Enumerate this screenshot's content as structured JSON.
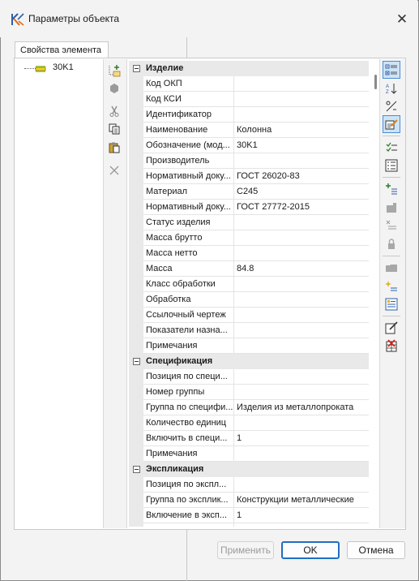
{
  "window": {
    "title": "Параметры объекта",
    "app_icon": "app-logo-icon",
    "close_icon": "close-icon"
  },
  "tab": {
    "label": "Свойства элемента"
  },
  "tree": {
    "node_label": "30K1",
    "node_icon": "beam-element-icon"
  },
  "left_toolbar": {
    "buttons": [
      "add-child-icon",
      "add-element-icon",
      "cut-icon",
      "copy-icon",
      "paste-icon",
      "delete-icon"
    ]
  },
  "grid": {
    "categories": [
      {
        "label": "Изделие",
        "rows": [
          {
            "name": "Код ОКП",
            "value": ""
          },
          {
            "name": "Код КСИ",
            "value": ""
          },
          {
            "name": "Идентификатор",
            "value": ""
          },
          {
            "name": "Наименование",
            "value": "Колонна"
          },
          {
            "name": "Обозначение (мод...",
            "value": "30K1"
          },
          {
            "name": "Производитель",
            "value": ""
          },
          {
            "name": "Нормативный доку...",
            "value": "ГОСТ 26020-83"
          },
          {
            "name": "Материал",
            "value": "С245"
          },
          {
            "name": "Нормативный доку...",
            "value": "ГОСТ 27772-2015"
          },
          {
            "name": "Статус изделия",
            "value": ""
          },
          {
            "name": "Масса брутто",
            "value": ""
          },
          {
            "name": "Масса нетто",
            "value": ""
          },
          {
            "name": "Масса",
            "value": "84.8"
          },
          {
            "name": "Класс обработки",
            "value": ""
          },
          {
            "name": "Обработка",
            "value": ""
          },
          {
            "name": "Ссылочный чертеж",
            "value": ""
          },
          {
            "name": "Показатели назна...",
            "value": ""
          },
          {
            "name": "Примечания",
            "value": ""
          }
        ]
      },
      {
        "label": "Спецификация",
        "rows": [
          {
            "name": "Позиция по специ...",
            "value": ""
          },
          {
            "name": "Номер группы",
            "value": ""
          },
          {
            "name": "Группа по специфи...",
            "value": "Изделия из металлопроката"
          },
          {
            "name": "Количество единиц",
            "value": ""
          },
          {
            "name": "Включить в специ...",
            "value": "1"
          },
          {
            "name": "Примечания",
            "value": ""
          }
        ]
      },
      {
        "label": "Экспликация",
        "rows": [
          {
            "name": "Позиция по экспл...",
            "value": ""
          },
          {
            "name": "Группа по эксплик...",
            "value": "Конструкции металлические"
          },
          {
            "name": "Включение в эксп...",
            "value": "1"
          },
          {
            "name": "",
            "value": ""
          }
        ]
      }
    ]
  },
  "right_toolbar": {
    "buttons": [
      "categorized-view-icon",
      "sort-alphabetical-icon",
      "formula-icon",
      "edit-properties-icon",
      "check-list-icon",
      "list-icon",
      "add-property-icon",
      "table-icon",
      "remove-property-icon",
      "lock-icon",
      "folder-icon",
      "new-item-icon",
      "properties-list-icon",
      "edit-form-icon",
      "delete-table-icon"
    ]
  },
  "footer": {
    "apply_label": "Применить",
    "ok_label": "OK",
    "cancel_label": "Отмена"
  }
}
